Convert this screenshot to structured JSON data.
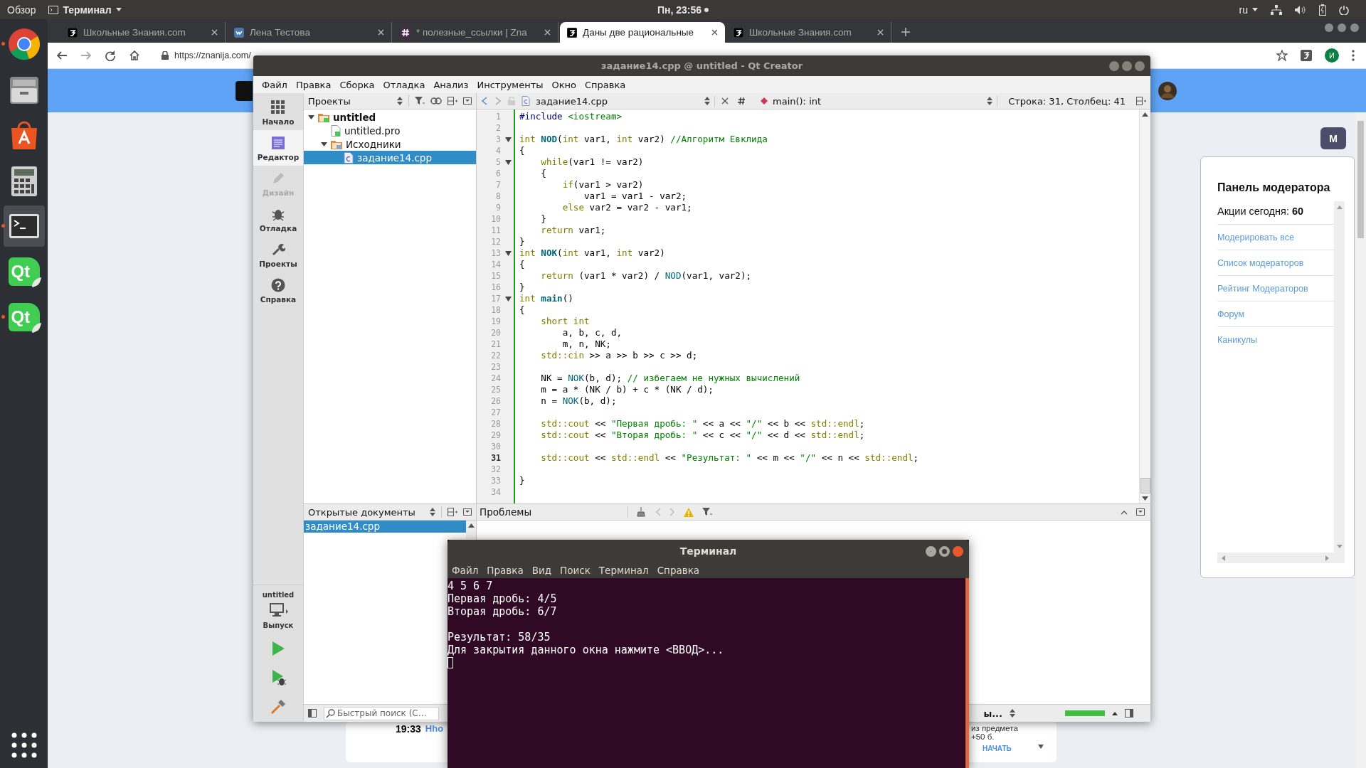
{
  "top_bar": {
    "activities": "Обзор",
    "app_menu": "Терминал",
    "clock": "Пн, 23:56",
    "language": "ru"
  },
  "dock": {
    "items": [
      {
        "kind": "browser",
        "running": true,
        "selected": false
      },
      {
        "kind": "files",
        "running": false,
        "selected": false
      },
      {
        "kind": "store",
        "running": false,
        "selected": false
      },
      {
        "kind": "calculator",
        "running": false,
        "selected": false
      },
      {
        "kind": "terminal",
        "running": true,
        "selected": true
      },
      {
        "kind": "qt",
        "label": "Qt",
        "running": false,
        "selected": false
      },
      {
        "kind": "qt",
        "label": "Qt",
        "running": true,
        "selected": false
      }
    ]
  },
  "browser": {
    "tabs": [
      {
        "kind": "znanija",
        "title": "Школьные Знания.com",
        "selected": false
      },
      {
        "kind": "vk",
        "title": "Лена Тестова",
        "selected": false
      },
      {
        "kind": "hash",
        "title": "* полезные_ссылки | Zna",
        "selected": false
      },
      {
        "kind": "znanija",
        "title": "Даны две рациональные",
        "selected": true
      },
      {
        "kind": "znanija",
        "title": "Школьные Знания.com",
        "selected": false
      }
    ],
    "url": "https://znanija.com/",
    "profile_initial": "И"
  },
  "page": {
    "moderator_badge": "М",
    "moderator_panel": {
      "title": "Панель модератора",
      "actions": "Акции сегодня: **60**",
      "links": [
        "Модерировать все",
        "Список модераторов",
        "Рейтинг Модераторов",
        "Форум",
        "Каникулы"
      ]
    },
    "task_card": {
      "time": "19:33",
      "name": "Hho",
      "subject": "из предмета",
      "points": "+50 б.",
      "start_button": "НАЧАТЬ"
    }
  },
  "qt_creator": {
    "title": "задание14.cpp @ untitled - Qt Creator",
    "menu": [
      "Файл",
      "Правка",
      "Сборка",
      "Отладка",
      "Анализ",
      "Инструменты",
      "Окно",
      "Справка"
    ],
    "modes": [
      {
        "kind": "welcome",
        "label": "Начало",
        "selected": false,
        "disabled": false
      },
      {
        "kind": "editor",
        "label": "Редактор",
        "selected": true,
        "disabled": false
      },
      {
        "kind": "design",
        "label": "Дизайн",
        "selected": false,
        "disabled": true
      },
      {
        "kind": "debug",
        "label": "Отладка",
        "selected": false,
        "disabled": false
      },
      {
        "kind": "projects",
        "label": "Проекты",
        "selected": false,
        "disabled": false
      },
      {
        "kind": "help",
        "label": "Справка",
        "selected": false,
        "disabled": false
      }
    ],
    "build": {
      "project": "untitled",
      "configuration": "Выпуск"
    },
    "projects_pane": {
      "title": "Проекты",
      "tree": [
        {
          "kind": "project",
          "label": "untitled",
          "expanded": true,
          "selected": false,
          "children": [
            {
              "kind": "pro",
              "label": "untitled.pro",
              "selected": false
            },
            {
              "kind": "folder",
              "label": "Исходники",
              "expanded": true,
              "selected": false,
              "children": [
                {
                  "kind": "cpp",
                  "label": "задание14.cpp",
                  "selected": true
                }
              ]
            }
          ]
        }
      ]
    },
    "open_documents": {
      "title": "Открытые документы",
      "items": [
        {
          "label": "задание14.cpp",
          "selected": true
        }
      ]
    },
    "editor": {
      "file": "задание14.cpp",
      "symbol": "main(): int",
      "position": "Строка: 31, Столбец: 41",
      "lines": [
        {
          "n": "1",
          "fold": false,
          "current": false,
          "segments": [
            {
              "kind": "pp",
              "text": "#include "
            },
            {
              "kind": "str",
              "text": "<iostream>"
            }
          ]
        },
        {
          "n": "2",
          "fold": false,
          "current": false
        },
        {
          "n": "3",
          "fold": true,
          "current": false,
          "segments": [
            {
              "kind": "kw",
              "text": "int"
            },
            {
              "kind": "def",
              "text": " NOD"
            },
            {
              "kind": "txt",
              "text": "("
            },
            {
              "kind": "kw",
              "text": "int"
            },
            {
              "kind": "txt",
              "text": " var1, "
            },
            {
              "kind": "kw",
              "text": "int"
            },
            {
              "kind": "txt",
              "text": " var2) "
            },
            {
              "kind": "cmt",
              "text": "//Алгоритм Евклида"
            }
          ]
        },
        {
          "n": "4",
          "fold": false,
          "current": false,
          "segments": [
            {
              "kind": "txt",
              "text": "{"
            }
          ]
        },
        {
          "n": "5",
          "fold": true,
          "current": false,
          "segments": [
            {
              "kind": "kw",
              "text": "    while"
            },
            {
              "kind": "txt",
              "text": "(var1 != var2)"
            }
          ]
        },
        {
          "n": "6",
          "fold": false,
          "current": false,
          "segments": [
            {
              "kind": "txt",
              "text": "    {"
            }
          ]
        },
        {
          "n": "7",
          "fold": false,
          "current": false,
          "segments": [
            {
              "kind": "kw",
              "text": "        if"
            },
            {
              "kind": "txt",
              "text": "(var1 > var2)"
            }
          ]
        },
        {
          "n": "8",
          "fold": false,
          "current": false,
          "segments": [
            {
              "kind": "txt",
              "text": "            var1 = var1 - var2;"
            }
          ]
        },
        {
          "n": "9",
          "fold": false,
          "current": false,
          "segments": [
            {
              "kind": "kw",
              "text": "        else"
            },
            {
              "kind": "txt",
              "text": " var2 = var2 - var1;"
            }
          ]
        },
        {
          "n": "10",
          "fold": false,
          "current": false,
          "segments": [
            {
              "kind": "txt",
              "text": "    }"
            }
          ]
        },
        {
          "n": "11",
          "fold": false,
          "current": false,
          "segments": [
            {
              "kind": "kw",
              "text": "    return"
            },
            {
              "kind": "txt",
              "text": " var1;"
            }
          ]
        },
        {
          "n": "12",
          "fold": false,
          "current": false,
          "segments": [
            {
              "kind": "txt",
              "text": "}"
            }
          ]
        },
        {
          "n": "13",
          "fold": true,
          "current": false,
          "segments": [
            {
              "kind": "kw",
              "text": "int"
            },
            {
              "kind": "def",
              "text": " NOK"
            },
            {
              "kind": "txt",
              "text": "("
            },
            {
              "kind": "kw",
              "text": "int"
            },
            {
              "kind": "txt",
              "text": " var1, "
            },
            {
              "kind": "kw",
              "text": "int"
            },
            {
              "kind": "txt",
              "text": " var2)"
            }
          ]
        },
        {
          "n": "14",
          "fold": false,
          "current": false,
          "segments": [
            {
              "kind": "txt",
              "text": "{"
            }
          ]
        },
        {
          "n": "15",
          "fold": false,
          "current": false,
          "segments": [
            {
              "kind": "kw",
              "text": "    return"
            },
            {
              "kind": "txt",
              "text": " (var1 * var2) / "
            },
            {
              "kind": "call",
              "text": "NOD"
            },
            {
              "kind": "txt",
              "text": "(var1, var2);"
            }
          ]
        },
        {
          "n": "16",
          "fold": false,
          "current": false,
          "segments": [
            {
              "kind": "txt",
              "text": "}"
            }
          ]
        },
        {
          "n": "17",
          "fold": true,
          "current": false,
          "segments": [
            {
              "kind": "kw",
              "text": "int"
            },
            {
              "kind": "def",
              "text": " main"
            },
            {
              "kind": "txt",
              "text": "()"
            }
          ]
        },
        {
          "n": "18",
          "fold": false,
          "current": false,
          "segments": [
            {
              "kind": "txt",
              "text": "{"
            }
          ]
        },
        {
          "n": "19",
          "fold": false,
          "current": false,
          "segments": [
            {
              "kind": "kw",
              "text": "    short int"
            }
          ]
        },
        {
          "n": "20",
          "fold": false,
          "current": false,
          "segments": [
            {
              "kind": "txt",
              "text": "        a, b, c, d,"
            }
          ]
        },
        {
          "n": "21",
          "fold": false,
          "current": false,
          "segments": [
            {
              "kind": "txt",
              "text": "        m, n, NK;"
            }
          ]
        },
        {
          "n": "22",
          "fold": false,
          "current": false,
          "segments": [
            {
              "kind": "ns",
              "text": "    std::cin"
            },
            {
              "kind": "txt",
              "text": " >> a >> b >> c >> d;"
            }
          ]
        },
        {
          "n": "23",
          "fold": false,
          "current": false
        },
        {
          "n": "24",
          "fold": false,
          "current": false,
          "segments": [
            {
              "kind": "txt",
              "text": "    NK = "
            },
            {
              "kind": "call",
              "text": "NOK"
            },
            {
              "kind": "txt",
              "text": "(b, d); "
            },
            {
              "kind": "cmt",
              "text": "// избегаем не нужных вычислений"
            }
          ]
        },
        {
          "n": "25",
          "fold": false,
          "current": false,
          "segments": [
            {
              "kind": "txt",
              "text": "    m = a * (NK / b) + c * (NK / d);"
            }
          ]
        },
        {
          "n": "26",
          "fold": false,
          "current": false,
          "segments": [
            {
              "kind": "txt",
              "text": "    n = "
            },
            {
              "kind": "call",
              "text": "NOK"
            },
            {
              "kind": "txt",
              "text": "(b, d);"
            }
          ]
        },
        {
          "n": "27",
          "fold": false,
          "current": false
        },
        {
          "n": "28",
          "fold": false,
          "current": false,
          "segments": [
            {
              "kind": "ns",
              "text": "    std::cout"
            },
            {
              "kind": "txt",
              "text": " << "
            },
            {
              "kind": "str",
              "text": "\"Первая дробь: \""
            },
            {
              "kind": "txt",
              "text": " << a << "
            },
            {
              "kind": "str",
              "text": "\"/\""
            },
            {
              "kind": "txt",
              "text": " << b << "
            },
            {
              "kind": "ns",
              "text": "std::endl"
            },
            {
              "kind": "txt",
              "text": ";"
            }
          ]
        },
        {
          "n": "29",
          "fold": false,
          "current": false,
          "segments": [
            {
              "kind": "ns",
              "text": "    std::cout"
            },
            {
              "kind": "txt",
              "text": " << "
            },
            {
              "kind": "str",
              "text": "\"Вторая дробь: \""
            },
            {
              "kind": "txt",
              "text": " << c << "
            },
            {
              "kind": "str",
              "text": "\"/\""
            },
            {
              "kind": "txt",
              "text": " << d << "
            },
            {
              "kind": "ns",
              "text": "std::endl"
            },
            {
              "kind": "txt",
              "text": ";"
            }
          ]
        },
        {
          "n": "30",
          "fold": false,
          "current": false
        },
        {
          "n": "31",
          "fold": false,
          "current": true,
          "segments": [
            {
              "kind": "ns",
              "text": "    std::cout"
            },
            {
              "kind": "txt",
              "text": " << "
            },
            {
              "kind": "ns",
              "text": "std::endl"
            },
            {
              "kind": "txt",
              "text": " << "
            },
            {
              "kind": "str",
              "text": "\"Результат: \""
            },
            {
              "kind": "txt",
              "text": " << m << "
            },
            {
              "kind": "str",
              "text": "\"/\""
            },
            {
              "kind": "txt",
              "text": " << n << "
            },
            {
              "kind": "ns",
              "text": "std::endl"
            },
            {
              "kind": "txt",
              "text": ";"
            }
          ]
        },
        {
          "n": "32",
          "fold": false,
          "current": false
        },
        {
          "n": "33",
          "fold": false,
          "current": false,
          "segments": [
            {
              "kind": "txt",
              "text": "}"
            }
          ]
        },
        {
          "n": "34",
          "fold": false,
          "current": false
        }
      ]
    },
    "problems": {
      "title": "Проблемы"
    },
    "status_bar": {
      "search_placeholder": "Быстрый поиск (С…",
      "output_tab": "ы..."
    }
  },
  "terminal": {
    "title": "Терминал",
    "menu": [
      "Файл",
      "Правка",
      "Вид",
      "Поиск",
      "Терминал",
      "Справка"
    ],
    "output": "4 5 6 7\nПервая дробь: 4/5\nВторая дробь: 6/7\n\nРезультат: 58/35\nДля закрытия данного окна нажмите <ВВОД>..."
  }
}
